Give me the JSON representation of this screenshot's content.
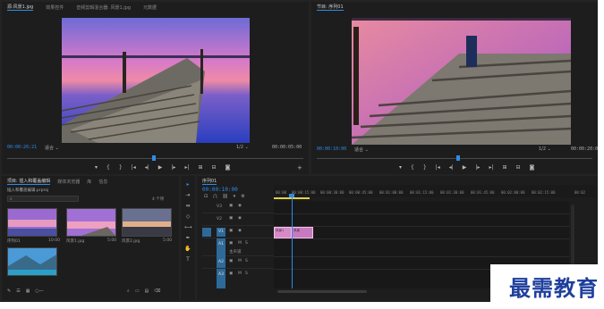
{
  "source_panel": {
    "tabs": [
      "源:风景1.jpg",
      "效果控件",
      "音频剪辑混合器: 风景1.jpg",
      "元数据"
    ],
    "timecode_current": "00:00:26:21",
    "fit_label": "适合",
    "fraction": "1/2",
    "timecode_duration": "00:00:05:00"
  },
  "program_panel": {
    "title": "节目: 序列01",
    "timecode_current": "00:00:10:00",
    "fit_label": "适合",
    "fraction": "1/2",
    "timecode_duration": "00:00:20:0"
  },
  "project_panel": {
    "tabs": [
      "项目: 插入和覆盖编辑",
      "媒体浏览器",
      "库",
      "信息"
    ],
    "file_name": "插入和覆盖编辑.prproj",
    "count": "4 个项",
    "items": [
      {
        "name": "序列01",
        "duration": "10:00"
      },
      {
        "name": "风景1.jpg",
        "duration": "5:00"
      },
      {
        "name": "风景2.jpg",
        "duration": "5:00"
      },
      {
        "name": "风景3.jpg",
        "duration": ""
      }
    ]
  },
  "timeline_panel": {
    "tab": "序列01",
    "timecode": "00:00:10:00",
    "tracks": [
      "V3",
      "V2",
      "V1",
      "A1",
      "A2",
      "A3"
    ],
    "audio_labels": [
      "主声道"
    ],
    "ruler": [
      "00:00",
      "00:00:15:00",
      "00:00:30:00",
      "00:00:45:00",
      "00:01:00:00",
      "00:01:15:00",
      "00:01:30:00",
      "00:01:45:00",
      "00:02:00:00",
      "00:02:15:00",
      "00:02"
    ],
    "clip_labels": [
      "风景1",
      "风景"
    ]
  },
  "watermark": "最需教育",
  "colors": {
    "accent": "#2d8ceb",
    "clip_pink": "#d88ac8",
    "panel_bg": "#1d1d1d"
  }
}
